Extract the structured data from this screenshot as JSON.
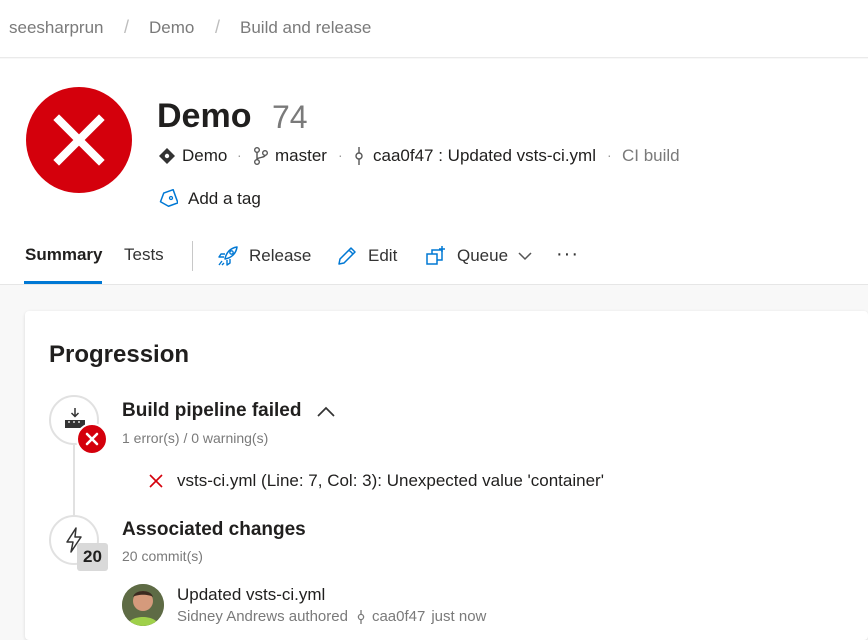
{
  "breadcrumb": {
    "items": [
      "seesharprun",
      "Demo",
      "Build and release"
    ],
    "separator": "/"
  },
  "build": {
    "status": "failed",
    "status_color": "#d4000c",
    "pipeline_name": "Demo",
    "run_number": "74",
    "repo": "Demo",
    "branch": "master",
    "commit": "caa0f47 : Updated vsts-ci.yml",
    "trigger": "CI build",
    "add_tag_label": "Add a tag"
  },
  "icons": {
    "status": "error-x-icon",
    "repo": "repo-diamond-icon",
    "branch": "branch-icon",
    "commit": "commit-icon",
    "tag": "tag-icon",
    "release": "rocket-icon",
    "edit": "pencil-icon",
    "queue": "queue-icon",
    "more": "more-ellipsis-icon"
  },
  "tabs": [
    {
      "label": "Summary",
      "active": true
    },
    {
      "label": "Tests",
      "active": false
    }
  ],
  "actions": {
    "release": "Release",
    "edit": "Edit",
    "queue": "Queue",
    "more": "···"
  },
  "accent_color": "#0078d4",
  "progression": {
    "title": "Progression",
    "pipeline_step": {
      "title": "Build pipeline failed",
      "subtitle": "1 error(s) / 0 warning(s)",
      "error_message": "vsts-ci.yml (Line: 7, Col: 3): Unexpected value 'container'"
    },
    "changes_step": {
      "title": "Associated changes",
      "subtitle": "20 commit(s)",
      "count": "20"
    },
    "commit": {
      "title": "Updated vsts-ci.yml",
      "author_text": "Sidney Andrews authored",
      "hash": "caa0f47",
      "when": "just now"
    }
  }
}
